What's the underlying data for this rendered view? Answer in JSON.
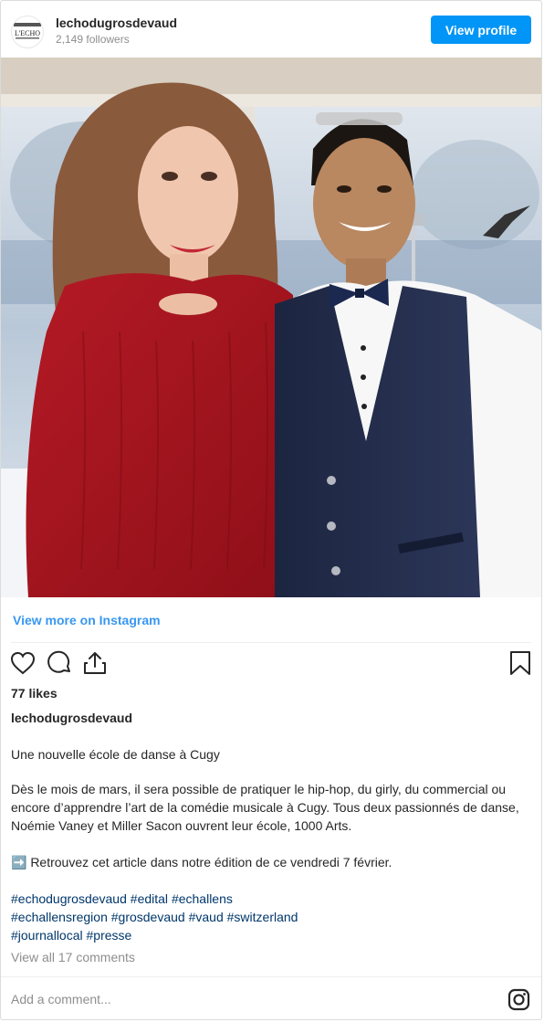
{
  "header": {
    "username": "lechodugrosdevaud",
    "followers": "2,149 followers",
    "view_profile_label": "View profile",
    "avatar_logo_text": "L'ECHO"
  },
  "post": {
    "image_alt": "Woman in red knit dress and man in white shirt with bow tie and navy vest smiling in front of a window",
    "view_more_label": "View more on Instagram",
    "likes": "77 likes",
    "caption_username": "lechodugrosdevaud",
    "caption_title": "Une nouvelle école de danse à Cugy",
    "caption_body": "Dès le mois de mars, il sera possible de pratiquer le hip-hop, du girly, du commercial ou encore d’apprendre l’art de la comédie musicale à Cugy. Tous deux passionnés de danse, Noémie Vaney et Miller Sacon ouvrent leur école, 1000 Arts.",
    "caption_cta": "➡️ Retrouvez cet article dans notre édition de ce vendredi 7 février.",
    "hashtags": [
      "#echodugrosdevaud",
      "#edital",
      "#echallens",
      "#echallensregion",
      "#grosdevaud",
      "#vaud",
      "#switzerland",
      "#journallocal",
      "#presse"
    ],
    "view_comments": "View all 17 comments",
    "comment_placeholder": "Add a comment..."
  },
  "icons": {
    "like": "heart-icon",
    "comment": "comment-bubble-icon",
    "share": "share-icon",
    "save": "bookmark-icon",
    "instagram": "instagram-logo-icon"
  },
  "colors": {
    "accent": "#0095f6",
    "link": "#3897f0",
    "hashtag": "#00376b",
    "muted": "#8e8e8e"
  }
}
